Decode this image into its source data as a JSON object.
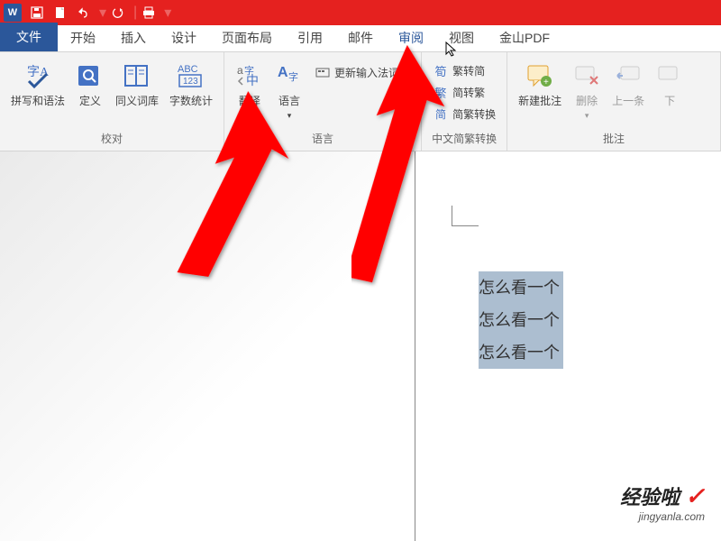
{
  "app": {
    "icon_letter": "W"
  },
  "qat": {
    "save": "💾",
    "new": "📄",
    "undo": "↶",
    "redo": "↻",
    "print": "🖶"
  },
  "tabs": {
    "file": "文件",
    "items": [
      "开始",
      "插入",
      "设计",
      "页面布局",
      "引用",
      "邮件",
      "审阅",
      "视图",
      "金山PDF"
    ],
    "active_index": 6
  },
  "ribbon": {
    "proofing": {
      "spelling": "拼写和语法",
      "define": "定义",
      "thesaurus": "同义词库",
      "wordcount": "字数统计",
      "label": "校对"
    },
    "language": {
      "translate": "翻译",
      "language": "语言",
      "ime": "更新输入法词典",
      "label": "语言"
    },
    "chinese": {
      "sc": "繁转简",
      "tc": "简转繁",
      "convert": "简繁转换",
      "label": "中文简繁转换"
    },
    "comments": {
      "new": "新建批注",
      "delete": "删除",
      "prev": "上一条",
      "next": "下",
      "label": "批注"
    }
  },
  "document": {
    "lines": [
      "怎么看一个",
      "怎么看一个",
      "怎么看一个"
    ]
  },
  "watermark": {
    "main": "经验啦",
    "sub": "jingyanla.com"
  }
}
